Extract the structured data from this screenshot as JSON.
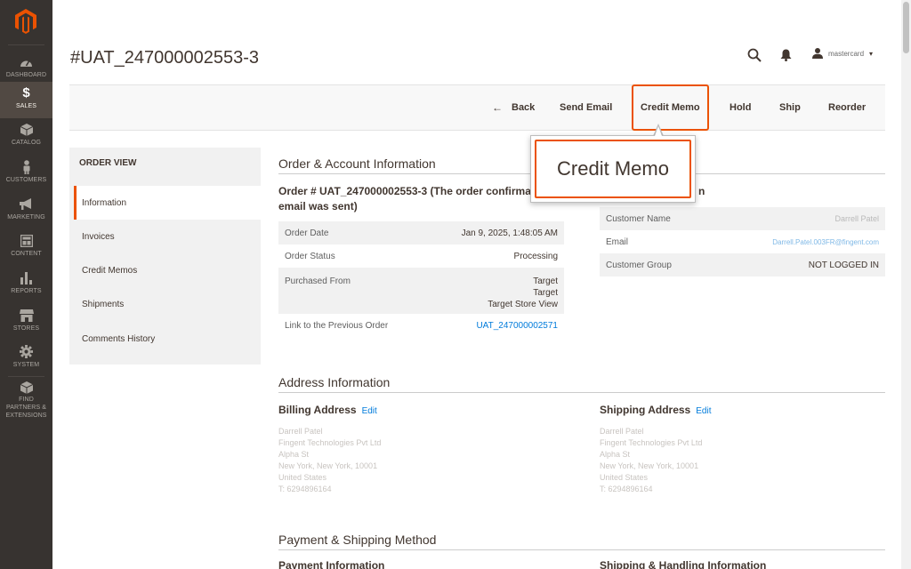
{
  "menu": {
    "items": [
      {
        "label": "DASHBOARD",
        "icon": "dashboard-icon"
      },
      {
        "label": "SALES",
        "icon": "dollar-icon"
      },
      {
        "label": "CATALOG",
        "icon": "box-icon"
      },
      {
        "label": "CUSTOMERS",
        "icon": "person-icon"
      },
      {
        "label": "MARKETING",
        "icon": "megaphone-icon"
      },
      {
        "label": "CONTENT",
        "icon": "layout-icon"
      },
      {
        "label": "REPORTS",
        "icon": "bar-chart-icon"
      },
      {
        "label": "STORES",
        "icon": "storefront-icon"
      },
      {
        "label": "SYSTEM",
        "icon": "gear-icon"
      },
      {
        "label": "FIND PARTNERS & EXTENSIONS",
        "icon": "package-icon"
      }
    ],
    "active_color": "#514943",
    "bg_color": "#373330"
  },
  "header": {
    "title": "#UAT_247000002553-3",
    "user": "mastercard"
  },
  "toolbar": {
    "back": "Back",
    "send_email": "Send Email",
    "credit_memo": "Credit Memo",
    "hold": "Hold",
    "ship": "Ship",
    "reorder": "Reorder"
  },
  "callout": {
    "text": "Credit Memo",
    "accent": "#eb5202"
  },
  "side_nav": {
    "title": "ORDER VIEW",
    "items": [
      "Information",
      "Invoices",
      "Credit Memos",
      "Shipments",
      "Comments History"
    ]
  },
  "order_account": {
    "section_title": "Order & Account Information",
    "order_heading": "Order # UAT_247000002553-3 (The order confirma",
    "order_heading_2": "email was sent)",
    "account_heading": "n",
    "order_rows": [
      {
        "label": "Order Date",
        "value": "Jan 9, 2025, 1:48:05 AM"
      },
      {
        "label": "Order Status",
        "value": "Processing"
      },
      {
        "label": "Purchased From",
        "value": "Target",
        "value2": "Target",
        "value3": "Target Store View"
      },
      {
        "label": "Link to the Previous Order",
        "value": "UAT_247000002571"
      }
    ],
    "account_rows": [
      {
        "label": "Customer Name",
        "value": "Darrell Patel"
      },
      {
        "label": "Email",
        "value": "Darrell.Patel.003FR@fingent.com"
      },
      {
        "label": "Customer Group",
        "value": "NOT LOGGED IN"
      }
    ]
  },
  "address": {
    "section_title": "Address Information",
    "billing_title": "Billing Address",
    "shipping_title": "Shipping Address",
    "edit": "Edit",
    "lines": [
      "Darrell Patel",
      "Fingent Technologies Pvt Ltd",
      "Alpha St",
      "New York, New York, 10001",
      "United States",
      "T: 6294896164"
    ]
  },
  "payment": {
    "section_title": "Payment & Shipping Method",
    "payment_info": "Payment Information",
    "shipping_info": "Shipping & Handling Information"
  }
}
